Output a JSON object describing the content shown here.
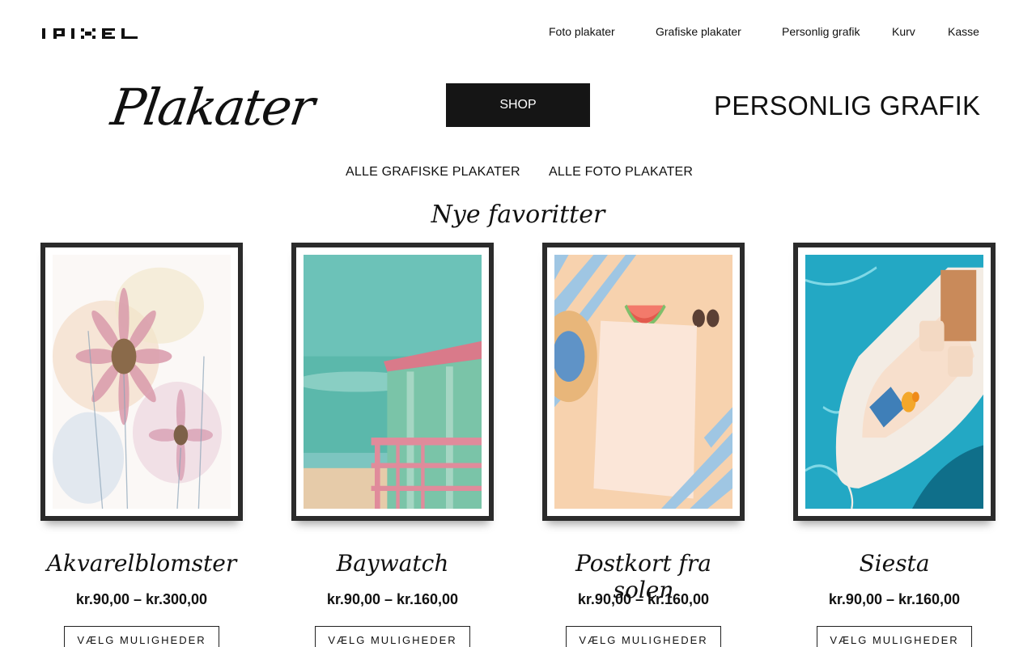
{
  "header": {
    "logo_text": "IPIXEL",
    "nav": [
      "Foto plakater",
      "Grafiske plakater",
      "Personlig grafik",
      "Kurv",
      "Kasse"
    ]
  },
  "hero": {
    "left_title": "Plakater",
    "shop_label": "SHOP",
    "right_title": "PERSONLIG GRAFIK"
  },
  "sublinks": [
    "ALLE GRAFISKE PLAKATER",
    "ALLE FOTO PLAKATER"
  ],
  "section_title": "Nye favoritter",
  "products": [
    {
      "name": "Akvarelblomster",
      "price": "kr.90,00 – kr.300,00",
      "button": "VÆLG MULIGHEDER",
      "image_icon": "watercolor-flowers-image"
    },
    {
      "name": "Baywatch",
      "price": "kr.90,00 – kr.160,00",
      "button": "VÆLG MULIGHEDER",
      "image_icon": "lifeguard-tower-image"
    },
    {
      "name": "Postkort fra solen",
      "price": "kr.90,00 – kr.160,00",
      "button": "VÆLG MULIGHEDER",
      "image_icon": "beach-postcard-image"
    },
    {
      "name": "Siesta",
      "price": "kr.90,00 – kr.160,00",
      "button": "VÆLG MULIGHEDER",
      "image_icon": "boat-aerial-image"
    }
  ]
}
